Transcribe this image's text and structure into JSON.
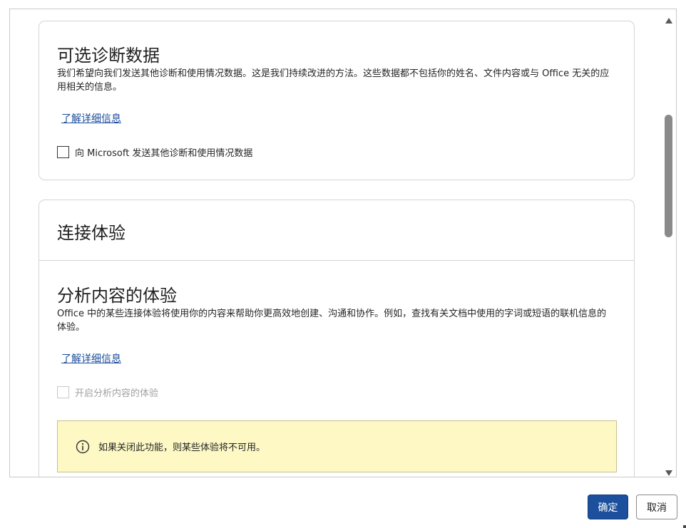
{
  "section_optional": {
    "title": "可选诊断数据",
    "description": "我们希望向我们发送其他诊断和使用情况数据。这是我们持续改进的方法。这些数据都不包括你的姓名、文件内容或与 Office 无关的应用相关的信息。",
    "learn_more": "了解详细信息",
    "checkbox_label": "向 Microsoft 发送其他诊断和使用情况数据",
    "checkbox_checked": false
  },
  "section_connected": {
    "title": "连接体验",
    "subsection": {
      "title": "分析内容的体验",
      "description": "Office 中的某些连接体验将使用你的内容来帮助你更高效地创建、沟通和协作。例如，查找有关文档中使用的字词或短语的联机信息的体验。",
      "learn_more": "了解详细信息",
      "checkbox_label": "开启分析内容的体验",
      "checkbox_checked": false,
      "checkbox_disabled": true,
      "notice": "如果关闭此功能，则某些体验将不可用。"
    }
  },
  "buttons": {
    "ok": "确定",
    "cancel": "取消"
  },
  "icons": {
    "info": "info-circle-icon",
    "scroll_up": "scroll-up-arrow-icon",
    "scroll_down": "scroll-down-arrow-icon"
  },
  "colors": {
    "primary_button": "#1c4f9c",
    "link": "#1b4d9c",
    "notice_bg": "#fdf8c4"
  }
}
